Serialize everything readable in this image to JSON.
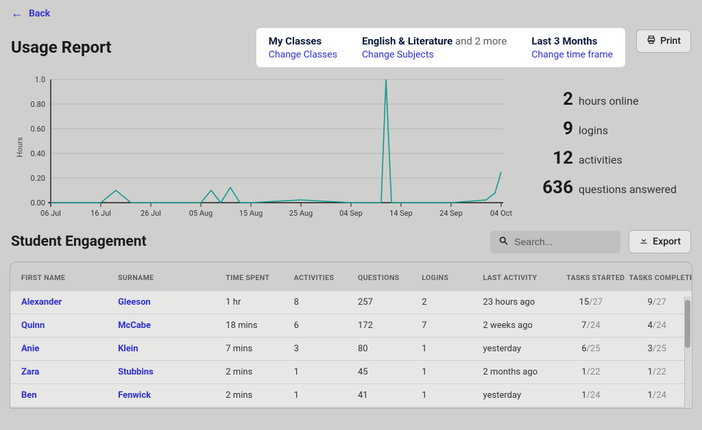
{
  "nav": {
    "back": "Back"
  },
  "title": "Usage Report",
  "filters": {
    "classes": {
      "title": "My Classes",
      "link": "Change Classes"
    },
    "subjects": {
      "title": "English & Literature",
      "extra": "and 2 more",
      "link": "Change Subjects"
    },
    "timeframe": {
      "title": "Last 3 Months",
      "link": "Change time frame"
    }
  },
  "buttons": {
    "print": "Print",
    "export": "Export"
  },
  "chart": {
    "ylabel": "Hours",
    "ticks_y": [
      "1.0",
      "0.80",
      "0.60",
      "0.40",
      "0.20",
      "0.00"
    ],
    "ticks_x": [
      "06 Jul",
      "16 Jul",
      "26 Jul",
      "05 Aug",
      "15 Aug",
      "25 Aug",
      "04 Sep",
      "14 Sep",
      "24 Sep",
      "04 Oct"
    ]
  },
  "chart_data": {
    "type": "line",
    "title": "",
    "xlabel": "",
    "ylabel": "Hours",
    "ylim": [
      0,
      1.0
    ],
    "x": [
      "06 Jul",
      "16 Jul",
      "19 Jul",
      "22 Jul",
      "26 Jul",
      "05 Aug",
      "07 Aug",
      "09 Aug",
      "11 Aug",
      "13 Aug",
      "15 Aug",
      "25 Aug",
      "04 Sep",
      "10 Sep",
      "11 Sep",
      "12 Sep",
      "14 Sep",
      "24 Sep",
      "01 Oct",
      "03 Oct",
      "04 Oct"
    ],
    "values": [
      0.0,
      0.0,
      0.1,
      0.0,
      0.0,
      0.0,
      0.1,
      0.0,
      0.12,
      0.0,
      0.0,
      0.02,
      0.0,
      0.0,
      1.0,
      0.0,
      0.0,
      0.0,
      0.02,
      0.08,
      0.25
    ]
  },
  "stats": {
    "hours": {
      "value": "2",
      "label": "hours online"
    },
    "logins": {
      "value": "9",
      "label": "logins"
    },
    "activities": {
      "value": "12",
      "label": "activities"
    },
    "questions": {
      "value": "636",
      "label": "questions answered"
    }
  },
  "section": {
    "title": "Student Engagement",
    "search_placeholder": "Search..."
  },
  "table": {
    "headers": {
      "first": "FIRST NAME",
      "surname": "SURNAME",
      "time": "TIME SPENT",
      "activities": "ACTIVITIES",
      "questions": "QUESTIONS",
      "logins": "LOGINS",
      "last": "LAST ACTIVITY",
      "started": "TASKS STARTED",
      "completed": "TASKS COMPLETED"
    },
    "rows": [
      {
        "first": "Alexander",
        "surname": "Gleeson",
        "time": "1 hr",
        "activities": "8",
        "questions": "257",
        "logins": "2",
        "last": "23 hours ago",
        "started": "15",
        "started_of": "27",
        "completed": "9",
        "completed_of": "27"
      },
      {
        "first": "Quinn",
        "surname": "McCabe",
        "time": "18 mins",
        "activities": "6",
        "questions": "172",
        "logins": "7",
        "last": "2 weeks ago",
        "started": "7",
        "started_of": "24",
        "completed": "4",
        "completed_of": "24"
      },
      {
        "first": "Anie",
        "surname": "Klein",
        "time": "7 mins",
        "activities": "3",
        "questions": "80",
        "logins": "1",
        "last": "yesterday",
        "started": "6",
        "started_of": "25",
        "completed": "3",
        "completed_of": "25"
      },
      {
        "first": "Zara",
        "surname": "Stubbins",
        "time": "2 mins",
        "activities": "1",
        "questions": "45",
        "logins": "1",
        "last": "2 months ago",
        "started": "1",
        "started_of": "22",
        "completed": "1",
        "completed_of": "22"
      },
      {
        "first": "Ben",
        "surname": "Fenwick",
        "time": "2 mins",
        "activities": "1",
        "questions": "41",
        "logins": "1",
        "last": "yesterday",
        "started": "1",
        "started_of": "24",
        "completed": "1",
        "completed_of": "24"
      }
    ]
  }
}
